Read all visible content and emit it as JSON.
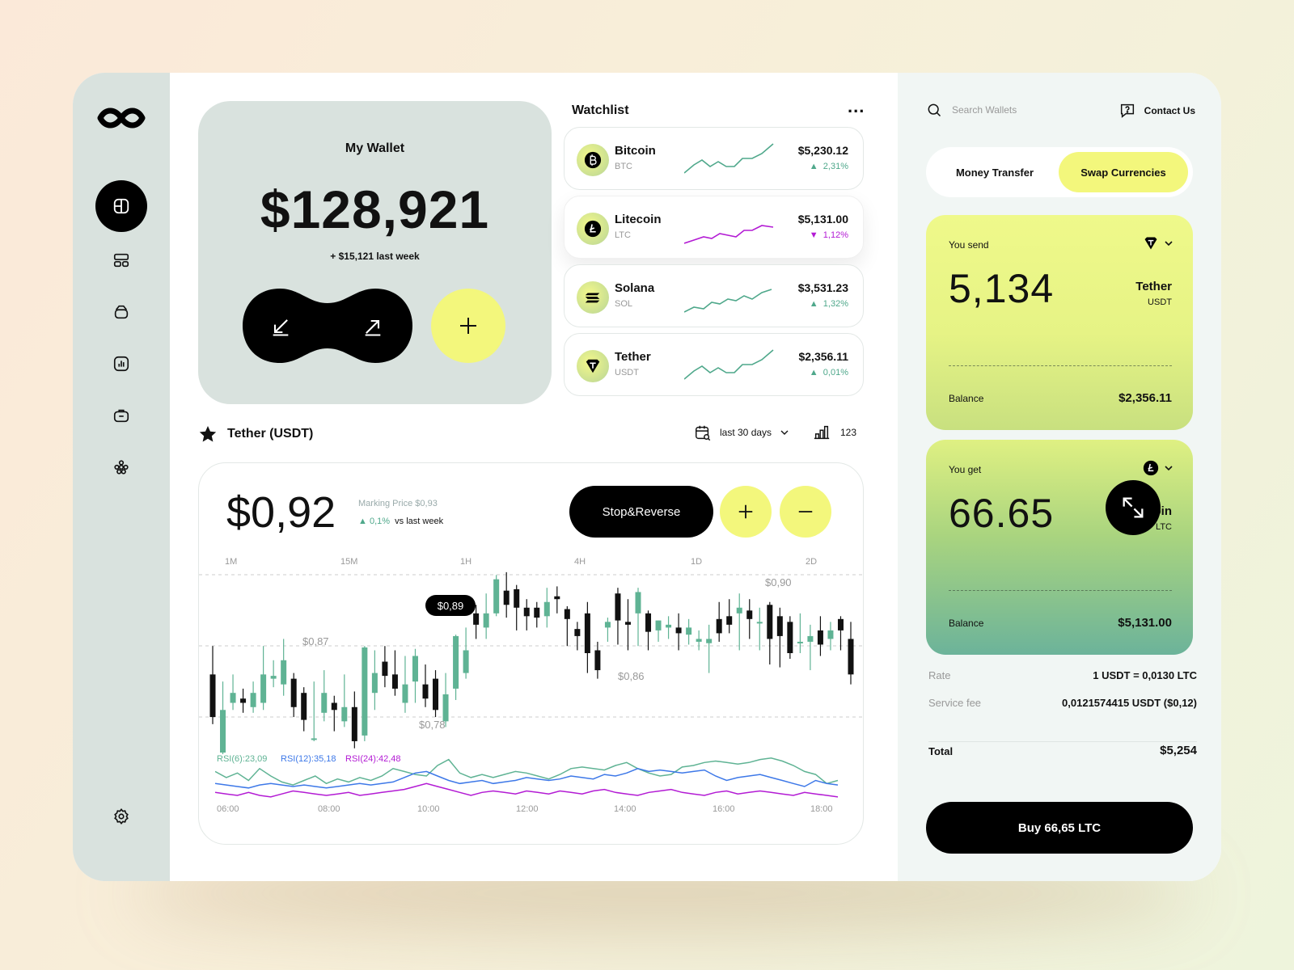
{
  "wallet": {
    "title": "My Wallet",
    "amount": "$128,921",
    "change": "+ $15,121 last week"
  },
  "watchlist": {
    "title": "Watchlist",
    "items": [
      {
        "name": "Bitcoin",
        "symbol": "BTC",
        "price": "$5,230.12",
        "change": "2,31%",
        "direction": "up",
        "icon": "bitcoin-icon"
      },
      {
        "name": "Litecoin",
        "symbol": "LTC",
        "price": "$5,131.00",
        "change": "1,12%",
        "direction": "down",
        "icon": "litecoin-icon"
      },
      {
        "name": "Solana",
        "symbol": "SOL",
        "price": "$3,531.23",
        "change": "1,32%",
        "direction": "up",
        "icon": "solana-icon"
      },
      {
        "name": "Tether",
        "symbol": "USDT",
        "price": "$2,356.11",
        "change": "0,01%",
        "direction": "up",
        "icon": "tether-icon"
      }
    ]
  },
  "chart_header": {
    "title": "Tether (USDT)",
    "range": "last 30 days",
    "volume": "123"
  },
  "chart": {
    "price": "$0,92",
    "marking_price": "Marking Price $0,93",
    "change": "0,1%",
    "change_label": "vs last week",
    "stop_reverse": "Stop&Reverse",
    "timeframes": [
      "1M",
      "15M",
      "1H",
      "4H",
      "1D",
      "2D"
    ],
    "price_labels": {
      "high": "$0,90",
      "mid_left": "$0,87",
      "mid_right": "$0,86",
      "low": "$0,78",
      "tooltip": "$0,89"
    },
    "rsi_labels": [
      "RSI(6):23,09",
      "RSI(12):35,18",
      "RSI(24):42,48"
    ],
    "times": [
      "06:00",
      "08:00",
      "10:00",
      "12:00",
      "14:00",
      "16:00",
      "18:00"
    ]
  },
  "chart_data": {
    "type": "candlestick",
    "ylim": [
      0.78,
      0.92
    ],
    "candles": [
      [
        0.835,
        0.805,
        0.855,
        0.8
      ],
      [
        0.78,
        0.81,
        0.83,
        0.775
      ],
      [
        0.815,
        0.822,
        0.835,
        0.81
      ],
      [
        0.818,
        0.815,
        0.825,
        0.808
      ],
      [
        0.812,
        0.822,
        0.83,
        0.808
      ],
      [
        0.815,
        0.835,
        0.855,
        0.81
      ],
      [
        0.832,
        0.834,
        0.845,
        0.826
      ],
      [
        0.828,
        0.845,
        0.86,
        0.82
      ],
      [
        0.832,
        0.812,
        0.836,
        0.805
      ],
      [
        0.822,
        0.803,
        0.826,
        0.795
      ],
      [
        0.79,
        0.79,
        0.83,
        0.788
      ],
      [
        0.808,
        0.822,
        0.838,
        0.802
      ],
      [
        0.815,
        0.81,
        0.82,
        0.795
      ],
      [
        0.802,
        0.812,
        0.835,
        0.798
      ],
      [
        0.812,
        0.788,
        0.823,
        0.783
      ],
      [
        0.792,
        0.854,
        0.855,
        0.788
      ],
      [
        0.822,
        0.836,
        0.852,
        0.81
      ],
      [
        0.844,
        0.834,
        0.855,
        0.826
      ],
      [
        0.835,
        0.825,
        0.852,
        0.82
      ],
      [
        0.815,
        0.828,
        0.848,
        0.808
      ],
      [
        0.83,
        0.848,
        0.853,
        0.815
      ],
      [
        0.828,
        0.818,
        0.842,
        0.812
      ],
      [
        0.832,
        0.81,
        0.838,
        0.805
      ],
      [
        0.802,
        0.821,
        0.836,
        0.798
      ],
      [
        0.825,
        0.862,
        0.863,
        0.817
      ],
      [
        0.836,
        0.852,
        0.868,
        0.832
      ],
      [
        0.878,
        0.87,
        0.884,
        0.86
      ],
      [
        0.868,
        0.878,
        0.892,
        0.86
      ],
      [
        0.878,
        0.902,
        0.905,
        0.876
      ],
      [
        0.894,
        0.884,
        0.907,
        0.875
      ],
      [
        0.895,
        0.882,
        0.898,
        0.866
      ],
      [
        0.882,
        0.876,
        0.888,
        0.866
      ],
      [
        0.882,
        0.875,
        0.886,
        0.868
      ],
      [
        0.876,
        0.886,
        0.896,
        0.868
      ],
      [
        0.89,
        0.888,
        0.897,
        0.878
      ],
      [
        0.881,
        0.874,
        0.883,
        0.855
      ],
      [
        0.867,
        0.862,
        0.872,
        0.852
      ],
      [
        0.878,
        0.85,
        0.886,
        0.836
      ],
      [
        0.852,
        0.838,
        0.858,
        0.832
      ],
      [
        0.868,
        0.872,
        0.875,
        0.858
      ],
      [
        0.892,
        0.873,
        0.896,
        0.856
      ],
      [
        0.872,
        0.87,
        0.888,
        0.852
      ],
      [
        0.878,
        0.893,
        0.896,
        0.855
      ],
      [
        0.878,
        0.865,
        0.88,
        0.852
      ],
      [
        0.866,
        0.873,
        0.873,
        0.858
      ],
      [
        0.868,
        0.87,
        0.876,
        0.86
      ],
      [
        0.868,
        0.864,
        0.878,
        0.852
      ],
      [
        0.863,
        0.868,
        0.874,
        0.856
      ],
      [
        0.858,
        0.86,
        0.866,
        0.852
      ],
      [
        0.857,
        0.86,
        0.87,
        0.836
      ],
      [
        0.874,
        0.864,
        0.886,
        0.858
      ],
      [
        0.876,
        0.87,
        0.888,
        0.864
      ],
      [
        0.878,
        0.882,
        0.892,
        0.852
      ],
      [
        0.88,
        0.874,
        0.888,
        0.86
      ],
      [
        0.872,
        0.872,
        0.882,
        0.852
      ],
      [
        0.884,
        0.86,
        0.886,
        0.842
      ],
      [
        0.876,
        0.862,
        0.882,
        0.84
      ],
      [
        0.872,
        0.85,
        0.876,
        0.846
      ],
      [
        0.858,
        0.858,
        0.878,
        0.85
      ],
      [
        0.858,
        0.862,
        0.87,
        0.838
      ],
      [
        0.866,
        0.856,
        0.876,
        0.848
      ],
      [
        0.86,
        0.866,
        0.872,
        0.852
      ],
      [
        0.874,
        0.866,
        0.876,
        0.852
      ],
      [
        0.86,
        0.835,
        0.872,
        0.828
      ]
    ],
    "rsi6": [
      58,
      54,
      57,
      52,
      60,
      55,
      51,
      49,
      52,
      55,
      50,
      53,
      51,
      54,
      52,
      55,
      60,
      58,
      56,
      55,
      62,
      66,
      57,
      54,
      56,
      54,
      56,
      58,
      57,
      55,
      53,
      56,
      60,
      61,
      60,
      59,
      62,
      64,
      60,
      57,
      55,
      56,
      61,
      62,
      64,
      65,
      64,
      63,
      64,
      66,
      67,
      65,
      62,
      58,
      56,
      50,
      52
    ],
    "rsi12": [
      50,
      49,
      48,
      47,
      49,
      50,
      49,
      48,
      49,
      48,
      47,
      48,
      49,
      50,
      49,
      50,
      51,
      54,
      57,
      58,
      55,
      52,
      50,
      51,
      52,
      50,
      51,
      52,
      54,
      53,
      52,
      53,
      55,
      54,
      53,
      56,
      55,
      57,
      60,
      58,
      59,
      58,
      57,
      58,
      59,
      55,
      52,
      54,
      55,
      56,
      54,
      52,
      50,
      48,
      52,
      50,
      49
    ],
    "rsi24": [
      44,
      43,
      42,
      44,
      42,
      41,
      43,
      45,
      44,
      43,
      42,
      43,
      44,
      42,
      43,
      44,
      45,
      46,
      48,
      50,
      48,
      46,
      44,
      42,
      44,
      45,
      44,
      43,
      45,
      44,
      43,
      45,
      44,
      43,
      45,
      46,
      44,
      43,
      42,
      44,
      45,
      46,
      44,
      43,
      42,
      44,
      45,
      43,
      44,
      45,
      44,
      43,
      42,
      44,
      43,
      42,
      41
    ]
  },
  "right": {
    "search_placeholder": "Search Wallets",
    "contact": "Contact Us",
    "tab_money": "Money Transfer",
    "tab_swap": "Swap Currencies",
    "send": {
      "label": "You send",
      "amount": "5,134",
      "currency": "Tether",
      "symbol": "USDT",
      "balance_label": "Balance",
      "balance": "$2,356.11"
    },
    "get": {
      "label": "You get",
      "amount": "66.65",
      "currency": "Litecoin",
      "symbol": "LTC",
      "balance_label": "Balance",
      "balance": "$5,131.00"
    },
    "rate_label": "Rate",
    "rate": "1 USDT = 0,0130 LTC",
    "fee_label": "Service fee",
    "fee": "0,0121574415 USDT ($0,12)",
    "total_label": "Total",
    "total": "$5,254",
    "buy": "Buy 66,65 LTC"
  },
  "colors": {
    "accent": "#f3f77c",
    "up": "#4fa88b",
    "down": "#b31bd4",
    "rsi6": "#5fb394",
    "rsi12": "#3d78e8",
    "rsi24": "#b31bd4"
  }
}
